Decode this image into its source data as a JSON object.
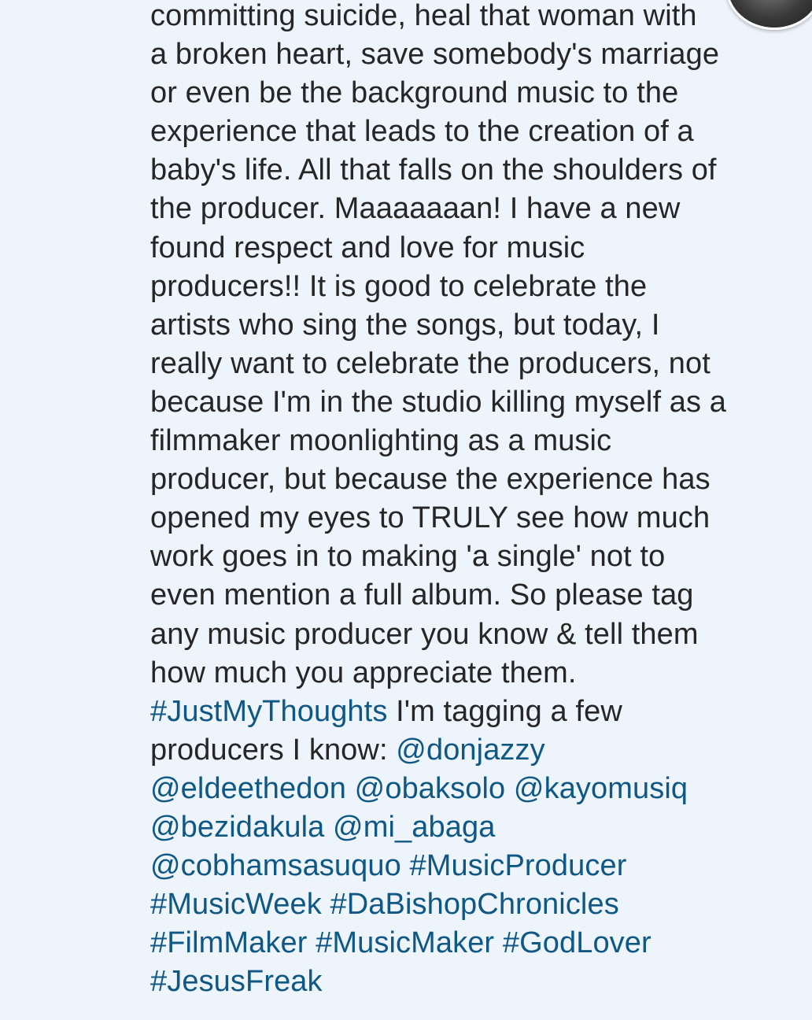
{
  "caption": {
    "lines": [
      [
        {
          "t": "committing suicide, heal that woman with"
        }
      ],
      [
        {
          "t": "a broken heart, save somebody's marriage"
        }
      ],
      [
        {
          "t": "or even be the background music to the"
        }
      ],
      [
        {
          "t": "experience that leads to the creation of a"
        }
      ],
      [
        {
          "t": "baby's life. All that falls on the shoulders of"
        }
      ],
      [
        {
          "t": "the producer. Maaaaaaan! I have a new"
        }
      ],
      [
        {
          "t": "found respect and love for music"
        }
      ],
      [
        {
          "t": "producers!! It is good to celebrate the"
        }
      ],
      [
        {
          "t": "artists who sing the songs, but today, I"
        }
      ],
      [
        {
          "t": "really want to celebrate the producers, not"
        }
      ],
      [
        {
          "t": "because I'm in the studio killing myself as a"
        }
      ],
      [
        {
          "t": "filmmaker moonlighting as a music"
        }
      ],
      [
        {
          "t": "producer, but because the experience has"
        }
      ],
      [
        {
          "t": "opened my eyes to TRULY see how much"
        }
      ],
      [
        {
          "t": "work goes in to making 'a single' not to"
        }
      ],
      [
        {
          "t": "even mention a full album. So please tag"
        }
      ],
      [
        {
          "t": "any music producer you know & tell them"
        }
      ],
      [
        {
          "t": "how much you appreciate them."
        }
      ],
      [
        {
          "t": "#JustMyThoughts",
          "link": true,
          "kind": "hashtag"
        },
        {
          "t": " I'm tagging a few"
        }
      ],
      [
        {
          "t": "producers I know: "
        },
        {
          "t": "@donjazzy",
          "link": true,
          "kind": "mention"
        }
      ],
      [
        {
          "t": "@eldeethedon",
          "link": true,
          "kind": "mention"
        },
        {
          "t": " "
        },
        {
          "t": "@obaksolo",
          "link": true,
          "kind": "mention"
        },
        {
          "t": " "
        },
        {
          "t": "@kayomusiq",
          "link": true,
          "kind": "mention"
        }
      ],
      [
        {
          "t": "@bezidakula",
          "link": true,
          "kind": "mention"
        },
        {
          "t": " "
        },
        {
          "t": "@mi_abaga",
          "link": true,
          "kind": "mention"
        }
      ],
      [
        {
          "t": "@cobhamsasuquo",
          "link": true,
          "kind": "mention"
        },
        {
          "t": " "
        },
        {
          "t": "#MusicProducer",
          "link": true,
          "kind": "hashtag"
        }
      ],
      [
        {
          "t": "#MusicWeek",
          "link": true,
          "kind": "hashtag"
        },
        {
          "t": " "
        },
        {
          "t": "#DaBishopChronicles",
          "link": true,
          "kind": "hashtag"
        }
      ],
      [
        {
          "t": "#FilmMaker",
          "link": true,
          "kind": "hashtag"
        },
        {
          "t": " "
        },
        {
          "t": "#MusicMaker",
          "link": true,
          "kind": "hashtag"
        },
        {
          "t": " "
        },
        {
          "t": "#GodLover",
          "link": true,
          "kind": "hashtag"
        }
      ],
      [
        {
          "t": "#JesusFreak",
          "link": true,
          "kind": "hashtag"
        }
      ]
    ]
  },
  "colors": {
    "background": "#eef4fb",
    "text": "#262626",
    "link": "#0f5785"
  },
  "icons": {
    "avatar": "profile-avatar"
  }
}
